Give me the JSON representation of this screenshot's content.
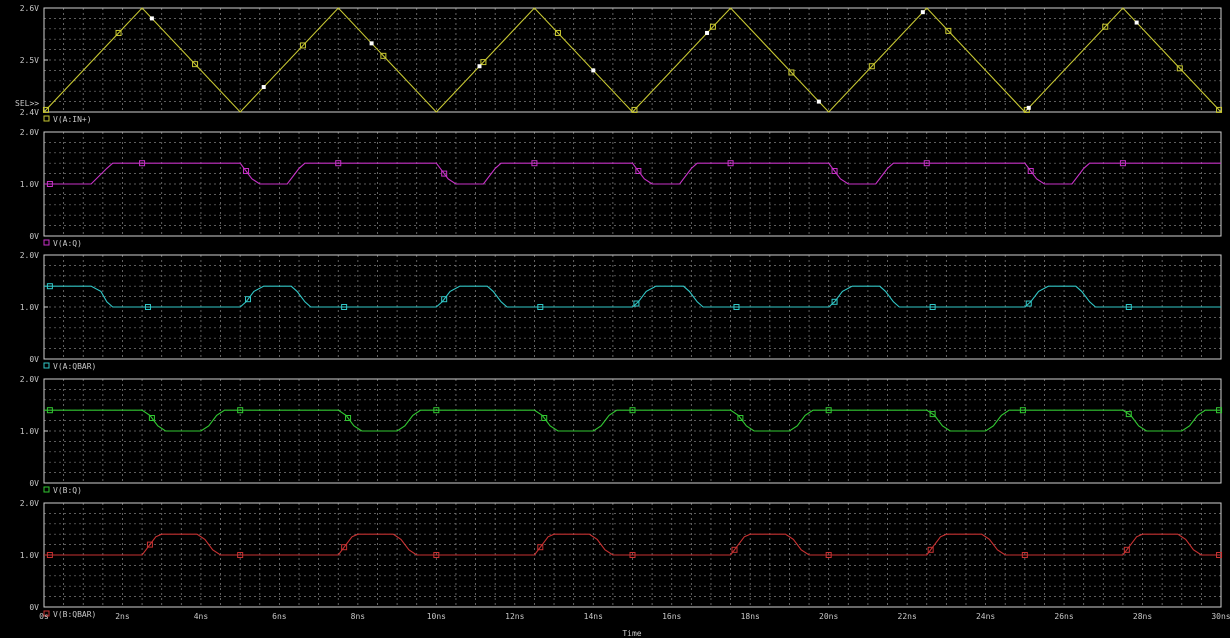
{
  "window": {
    "background": "#000000",
    "frame_color": "#d0d0d0",
    "grid_color": "#7a7a7a",
    "text_color": "#c8c8c8"
  },
  "cursor_label": "SEL>>",
  "x_axis": {
    "title": "Time",
    "ticks": [
      "0s",
      "2ns",
      "4ns",
      "6ns",
      "8ns",
      "10ns",
      "12ns",
      "14ns",
      "16ns",
      "18ns",
      "20ns",
      "22ns",
      "24ns",
      "26ns",
      "28ns",
      "30ns"
    ]
  },
  "chart_data": [
    {
      "type": "line",
      "title": "",
      "legend": "V(A:IN+)",
      "marker": "square",
      "color": "#c8c832",
      "xlim": [
        0,
        30
      ],
      "ylim": [
        2.4,
        2.6
      ],
      "ytick_labels": [
        "2.4V",
        "2.5V",
        "2.6V"
      ],
      "ytick_values": [
        2.4,
        2.5,
        2.6
      ],
      "series": [
        {
          "name": "V(A:IN+)",
          "x": [
            0,
            2.5,
            5,
            7.5,
            10,
            12.5,
            15,
            17.5,
            20,
            22.5,
            25,
            27.5,
            30
          ],
          "y": [
            2.4,
            2.6,
            2.4,
            2.6,
            2.4,
            2.6,
            2.4,
            2.6,
            2.4,
            2.6,
            2.4,
            2.6,
            2.4
          ]
        }
      ],
      "markers_x": [
        0.05,
        1.9,
        3.85,
        6.6,
        8.65,
        11.2,
        13.1,
        15.05,
        17.05,
        19.05,
        21.1,
        23.05,
        25.05,
        27.05,
        28.95,
        29.95
      ],
      "white_markers_x": [
        2.75,
        5.6,
        8.35,
        11.1,
        14.0,
        16.9,
        19.75,
        22.4,
        25.1,
        27.85
      ]
    },
    {
      "type": "line",
      "title": "",
      "legend": "V(A:Q)",
      "marker": "square",
      "color": "#c832c8",
      "xlim": [
        0,
        30
      ],
      "ylim": [
        0,
        2.0
      ],
      "ytick_labels": [
        "0V",
        "1.0V",
        "2.0V"
      ],
      "ytick_values": [
        0,
        1.0,
        2.0
      ],
      "series": [
        {
          "name": "V(A:Q)",
          "x": [
            0,
            1.2,
            1.6,
            1.75,
            2.0,
            5.0,
            5.1,
            5.3,
            5.5,
            6.2,
            6.5,
            6.65,
            7.0,
            10.0,
            10.1,
            10.3,
            10.5,
            11.2,
            11.5,
            11.65,
            12.0,
            15.0,
            15.1,
            15.3,
            15.5,
            16.2,
            16.5,
            16.65,
            17.0,
            20.0,
            20.1,
            20.3,
            20.5,
            21.2,
            21.5,
            21.65,
            22.0,
            25.0,
            25.1,
            25.3,
            25.5,
            26.2,
            26.5,
            26.65,
            27.0,
            30.0
          ],
          "y": [
            1.0,
            1.0,
            1.3,
            1.4,
            1.4,
            1.4,
            1.3,
            1.1,
            1.0,
            1.0,
            1.3,
            1.4,
            1.4,
            1.4,
            1.3,
            1.1,
            1.0,
            1.0,
            1.3,
            1.4,
            1.4,
            1.4,
            1.3,
            1.1,
            1.0,
            1.0,
            1.3,
            1.4,
            1.4,
            1.4,
            1.3,
            1.1,
            1.0,
            1.0,
            1.3,
            1.4,
            1.4,
            1.4,
            1.3,
            1.1,
            1.0,
            1.0,
            1.3,
            1.4,
            1.4,
            1.4
          ]
        }
      ],
      "markers_x": [
        0.15,
        2.5,
        5.15,
        7.5,
        10.2,
        12.5,
        15.15,
        17.5,
        20.15,
        22.5,
        25.15,
        27.5
      ]
    },
    {
      "type": "line",
      "title": "",
      "legend": "V(A:QBAR)",
      "marker": "square",
      "color": "#32c8c8",
      "xlim": [
        0,
        30
      ],
      "ylim": [
        0,
        2.0
      ],
      "ytick_labels": [
        "0V",
        "1.0V",
        "2.0V"
      ],
      "ytick_values": [
        0,
        1.0,
        2.0
      ],
      "series": [
        {
          "name": "V(A:QBAR)",
          "x": [
            0,
            1.2,
            1.45,
            1.6,
            1.75,
            5.0,
            5.15,
            5.35,
            5.6,
            6.3,
            6.45,
            6.65,
            6.8,
            10.0,
            10.15,
            10.35,
            10.6,
            11.3,
            11.45,
            11.65,
            11.8,
            15.0,
            15.15,
            15.35,
            15.6,
            16.3,
            16.45,
            16.65,
            16.8,
            20.0,
            20.15,
            20.35,
            20.6,
            21.3,
            21.45,
            21.65,
            21.8,
            25.0,
            25.15,
            25.35,
            25.6,
            26.3,
            26.45,
            26.65,
            26.8,
            30.0
          ],
          "y": [
            1.4,
            1.4,
            1.3,
            1.1,
            1.0,
            1.0,
            1.1,
            1.3,
            1.4,
            1.4,
            1.3,
            1.1,
            1.0,
            1.0,
            1.1,
            1.3,
            1.4,
            1.4,
            1.3,
            1.1,
            1.0,
            1.0,
            1.1,
            1.3,
            1.4,
            1.4,
            1.3,
            1.1,
            1.0,
            1.0,
            1.1,
            1.3,
            1.4,
            1.4,
            1.3,
            1.1,
            1.0,
            1.0,
            1.1,
            1.3,
            1.4,
            1.4,
            1.3,
            1.1,
            1.0,
            1.0
          ]
        }
      ],
      "markers_x": [
        0.15,
        2.65,
        5.2,
        7.65,
        10.2,
        12.65,
        15.1,
        17.65,
        20.15,
        22.65,
        25.1,
        27.65
      ]
    },
    {
      "type": "line",
      "title": "",
      "legend": "V(B:Q)",
      "marker": "square",
      "color": "#32c832",
      "xlim": [
        0,
        30
      ],
      "ylim": [
        0,
        2.0
      ],
      "ytick_labels": [
        "0V",
        "1.0V",
        "2.0V"
      ],
      "ytick_values": [
        0,
        1.0,
        2.0
      ],
      "series": [
        {
          "name": "V(B:Q)",
          "x": [
            0,
            2.5,
            2.7,
            2.9,
            3.1,
            4.0,
            4.2,
            4.4,
            4.6,
            7.5,
            7.7,
            7.9,
            8.1,
            9.0,
            9.2,
            9.4,
            9.6,
            12.5,
            12.7,
            12.9,
            13.1,
            14.0,
            14.2,
            14.4,
            14.6,
            17.5,
            17.7,
            17.9,
            18.1,
            19.0,
            19.2,
            19.4,
            19.6,
            22.5,
            22.7,
            22.9,
            23.1,
            24.0,
            24.2,
            24.4,
            24.6,
            27.5,
            27.7,
            27.9,
            28.1,
            29.0,
            29.2,
            29.4,
            29.6,
            30.0
          ],
          "y": [
            1.4,
            1.4,
            1.3,
            1.1,
            1.0,
            1.0,
            1.1,
            1.3,
            1.4,
            1.4,
            1.3,
            1.1,
            1.0,
            1.0,
            1.1,
            1.3,
            1.4,
            1.4,
            1.3,
            1.1,
            1.0,
            1.0,
            1.1,
            1.3,
            1.4,
            1.4,
            1.3,
            1.1,
            1.0,
            1.0,
            1.1,
            1.3,
            1.4,
            1.4,
            1.3,
            1.1,
            1.0,
            1.0,
            1.1,
            1.3,
            1.4,
            1.4,
            1.3,
            1.1,
            1.0,
            1.0,
            1.1,
            1.3,
            1.4,
            1.4
          ]
        }
      ],
      "markers_x": [
        0.15,
        2.75,
        5.0,
        7.75,
        10.0,
        12.75,
        15.0,
        17.75,
        20.0,
        22.65,
        24.95,
        27.65,
        29.95
      ]
    },
    {
      "type": "line",
      "title": "",
      "legend": "V(B:QBAR)",
      "marker": "square",
      "color": "#c83232",
      "xlim": [
        0,
        30
      ],
      "ylim": [
        0,
        2.0
      ],
      "ytick_labels": [
        "0V",
        "1.0V",
        "2.0V"
      ],
      "ytick_values": [
        0,
        1.0,
        2.0
      ],
      "series": [
        {
          "name": "V(B:QBAR)",
          "x": [
            0,
            2.5,
            2.7,
            2.85,
            3.0,
            3.9,
            4.1,
            4.3,
            4.5,
            7.5,
            7.7,
            7.85,
            8.0,
            8.9,
            9.1,
            9.3,
            9.5,
            12.5,
            12.7,
            12.85,
            13.0,
            13.9,
            14.1,
            14.3,
            14.5,
            17.5,
            17.7,
            17.85,
            18.0,
            18.9,
            19.1,
            19.3,
            19.5,
            22.5,
            22.7,
            22.85,
            23.0,
            23.9,
            24.1,
            24.3,
            24.5,
            27.5,
            27.7,
            27.85,
            28.0,
            28.9,
            29.1,
            29.3,
            29.5,
            30.0
          ],
          "y": [
            1.0,
            1.0,
            1.2,
            1.35,
            1.4,
            1.4,
            1.3,
            1.1,
            1.0,
            1.0,
            1.2,
            1.35,
            1.4,
            1.4,
            1.3,
            1.1,
            1.0,
            1.0,
            1.2,
            1.35,
            1.4,
            1.4,
            1.3,
            1.1,
            1.0,
            1.0,
            1.2,
            1.35,
            1.4,
            1.4,
            1.3,
            1.1,
            1.0,
            1.0,
            1.2,
            1.35,
            1.4,
            1.4,
            1.3,
            1.1,
            1.0,
            1.0,
            1.2,
            1.35,
            1.4,
            1.4,
            1.3,
            1.1,
            1.0,
            1.0
          ]
        }
      ],
      "markers_x": [
        0.15,
        2.7,
        5.0,
        7.65,
        10.0,
        12.65,
        15.0,
        17.6,
        20.0,
        22.6,
        25.0,
        27.6,
        29.95
      ]
    }
  ]
}
